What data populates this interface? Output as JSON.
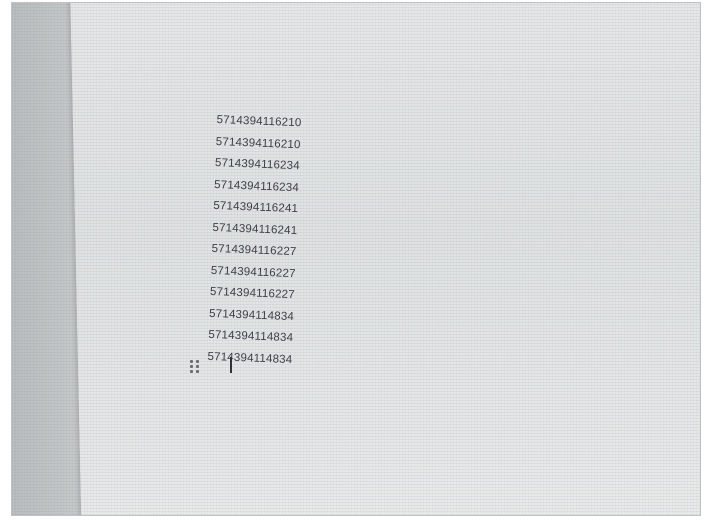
{
  "document": {
    "numbers": [
      "5714394116210",
      "5714394116210",
      "5714394116234",
      "5714394116234",
      "5714394116241",
      "5714394116241",
      "5714394116227",
      "5714394116227",
      "5714394116227",
      "5714394114834",
      "5714394114834",
      "5714394114834"
    ]
  },
  "icons": {
    "drag_handle": "drag-handle-icon",
    "cursor": "text-cursor-icon"
  },
  "colors": {
    "text": "#3b3e44",
    "page": "#e2e4e5",
    "background": "#d2d5d6"
  }
}
